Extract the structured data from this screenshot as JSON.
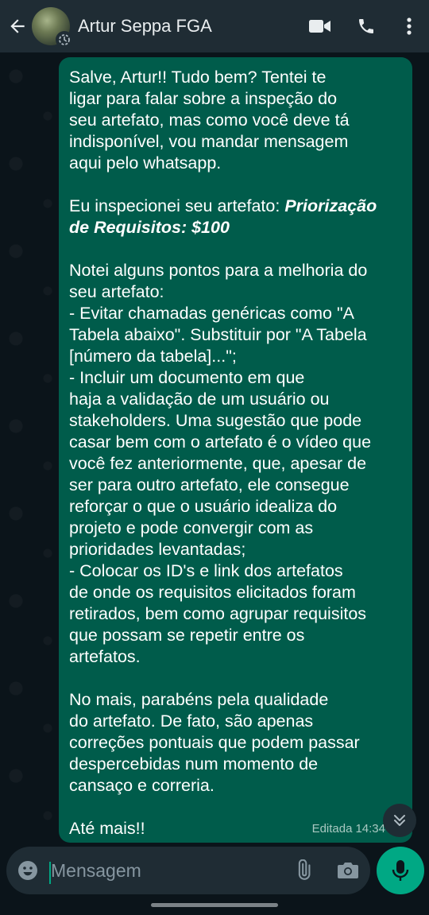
{
  "header": {
    "contact_name": "Artur Seppa FGA"
  },
  "message": {
    "intro": "Salve, Artur!! Tudo bem? Tentei te\nligar para falar sobre a inspeção do\nseu artefato, mas como você deve tá\nindisponível, vou mandar mensagem\naqui pelo whatsapp.",
    "inspected_prefix": "Eu inspecionei seu artefato: ",
    "inspected_title_line1": "Priorização",
    "inspected_title_line2": "de Requisitos: $100",
    "points": "Notei alguns pontos para a melhoria do\nseu artefato:\n- Evitar chamadas genéricas como \"A\nTabela abaixo\". Substituir por \"A Tabela\n[número da tabela]...\";\n- Incluir um documento em que\nhaja a validação de um usuário ou\nstakeholders. Uma sugestão que pode\ncasar bem com o artefato é o vídeo que\nvocê fez anteriormente, que, apesar de\nser para outro artefato, ele consegue\nreforçar o que o usuário idealiza do\nprojeto e pode convergir com as\nprioridades levantadas;\n- Colocar os ID's e link dos artefatos\nde onde os requisitos elicitados foram\nretirados, bem como agrupar requisitos\nque possam se repetir entre os\nartefatos.",
    "closing": "No mais, parabéns pela qualidade\ndo artefato. De fato, são apenas\ncorreções pontuais que podem passar\ndespercebidas num momento de\ncansaço e correria.",
    "signoff": "Até mais!!",
    "edited_label": "Editada",
    "time": "14:34"
  },
  "input": {
    "placeholder": "Mensagem"
  },
  "colors": {
    "header_bg": "#1f2c34",
    "chat_bg": "#0b141a",
    "bubble_bg": "#005c4b",
    "accent": "#00a884"
  }
}
